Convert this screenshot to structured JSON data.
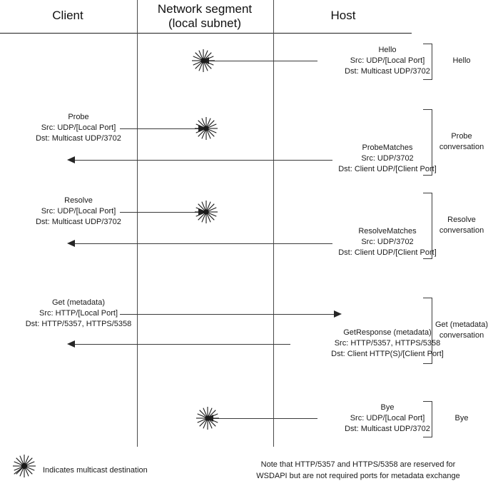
{
  "lanes": {
    "client": "Client",
    "network": "Network segment\n(local subnet)",
    "host": "Host"
  },
  "messages": {
    "hello": {
      "title": "Hello",
      "src": "Src: UDP/[Local Port]",
      "dst": "Dst: Multicast UDP/3702"
    },
    "probe": {
      "title": "Probe",
      "src": "Src: UDP/[Local Port]",
      "dst": "Dst: Multicast UDP/3702"
    },
    "probe_matches": {
      "title": "ProbeMatches",
      "src": "Src: UDP/3702",
      "dst": "Dst: Client UDP/[Client Port]"
    },
    "resolve": {
      "title": "Resolve",
      "src": "Src: UDP/[Local Port]",
      "dst": "Dst: Multicast UDP/3702"
    },
    "resolve_matches": {
      "title": "ResolveMatches",
      "src": "Src: UDP/3702",
      "dst": "Dst: Client UDP/[Client Port]"
    },
    "get_metadata": {
      "title": "Get (metadata)",
      "src": "Src: HTTP/[Local Port]",
      "dst": "Dst: HTTP/5357, HTTPS/5358"
    },
    "get_response": {
      "title": "GetResponse (metadata)",
      "src": "Src: HTTP/5357, HTTPS/5358",
      "dst": "Dst: Client HTTP(S)/[Client Port]"
    },
    "bye": {
      "title": "Bye",
      "src": "Src: UDP/[Local Port]",
      "dst": "Dst: Multicast UDP/3702"
    }
  },
  "conversations": {
    "hello": "Hello",
    "probe": "Probe\nconversation",
    "resolve": "Resolve\nconversation",
    "get_metadata": "Get (metadata)\nconversation",
    "bye": "Bye"
  },
  "footer": {
    "legend": "Indicates multicast destination",
    "note": "Note that HTTP/5357 and HTTPS/5358 are reserved for\nWSDAPI but are not required ports for metadata exchange"
  },
  "colors": {
    "line": "#3a3a3a",
    "rule": "#1d1d1d",
    "text": "#1a1a1a",
    "burst": "#1a1a1a"
  }
}
